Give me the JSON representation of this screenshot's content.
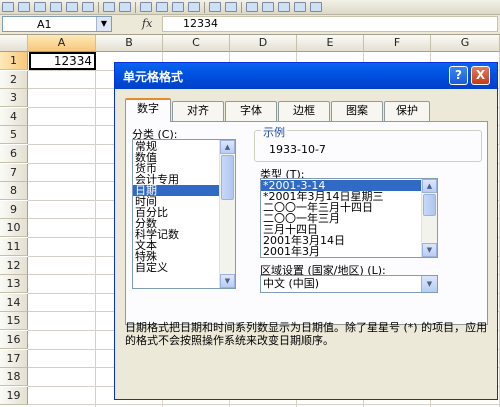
{
  "formula_bar": {
    "name_box": "A1",
    "fx": "fx",
    "value": "12334"
  },
  "sheet": {
    "columns": [
      "A",
      "B",
      "C",
      "D",
      "E",
      "F",
      "G"
    ],
    "rows": [
      "1",
      "2",
      "3",
      "4",
      "5",
      "6",
      "7",
      "8",
      "9",
      "10",
      "11",
      "12",
      "13",
      "14",
      "15",
      "16",
      "17",
      "18",
      "19"
    ],
    "cell_a1": "12334"
  },
  "dialog": {
    "title": "单元格格式",
    "help": "?",
    "close": "X",
    "tabs": [
      "数字",
      "对齐",
      "字体",
      "边框",
      "图案",
      "保护"
    ],
    "category_label": "分类 (C):",
    "categories": [
      "常规",
      "数值",
      "货币",
      "会计专用",
      "日期",
      "时间",
      "百分比",
      "分数",
      "科学记数",
      "文本",
      "特殊",
      "自定义"
    ],
    "sample_label": "示例",
    "sample_value": "1933-10-7",
    "type_label": "类型 (T):",
    "types": [
      "*2001-3-14",
      "*2001年3月14日星期三",
      "二〇〇一年三月十四日",
      "二〇〇一年三月",
      "三月十四日",
      "2001年3月14日",
      "2001年3月"
    ],
    "locale_label": "区域设置 (国家/地区) (L):",
    "locale_value": "中文 (中国)",
    "description": "日期格式把日期和时间系列数显示为日期值。除了星星号 (*) 的项目，应用的格式不会按照操作系统来改变日期顺序。"
  }
}
